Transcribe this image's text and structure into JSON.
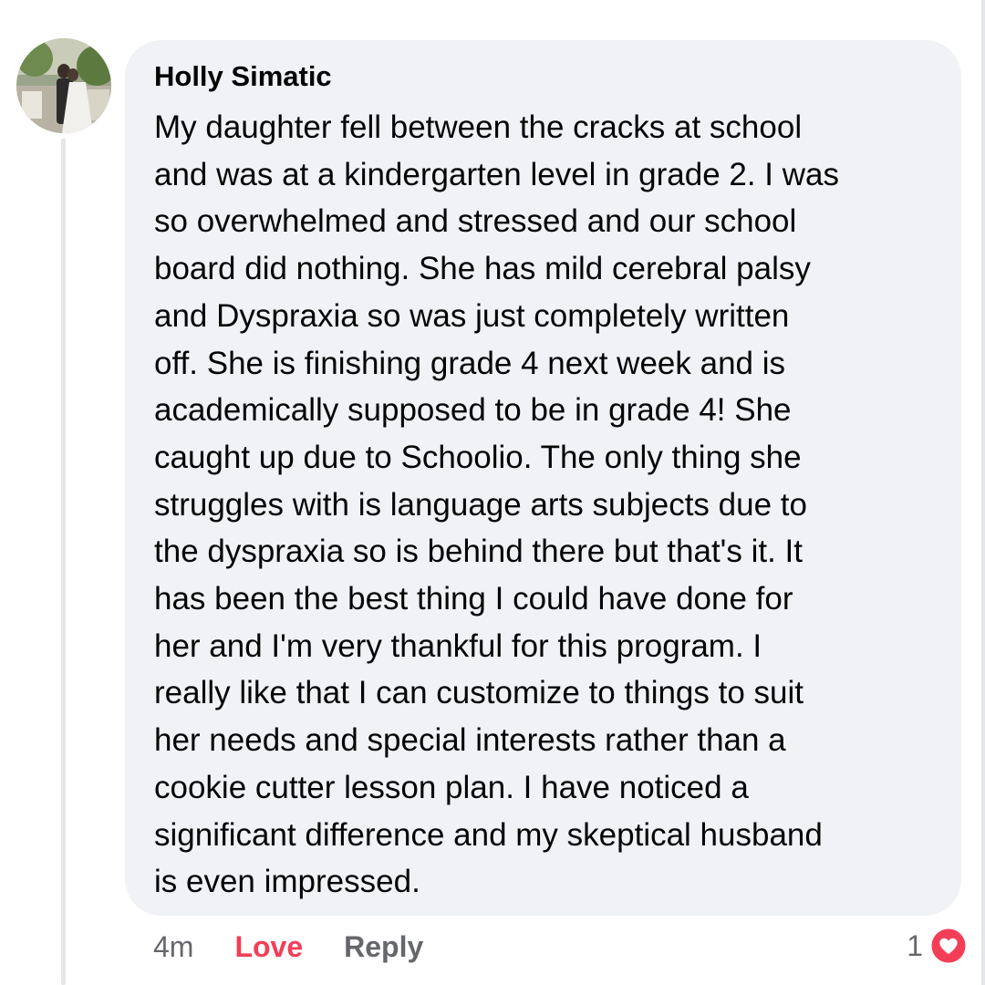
{
  "comment": {
    "author": "Holly Simatic",
    "lines": [
      "My daughter fell between the cracks at school",
      "and was at a kindergarten level in grade 2.  I was",
      "so overwhelmed and stressed and our school",
      "board did nothing.  She has mild cerebral palsy",
      "and Dyspraxia so was just completely written",
      "off. She is finishing grade 4 next week and is",
      "academically supposed to be in grade 4! She",
      "caught up due to Schoolio. The only thing she",
      "struggles with is language arts subjects due to",
      "the dyspraxia so is behind there but that's it. It",
      "has been the best thing I could have done for",
      "her and I'm very thankful for this program. I",
      "really like that I can customize to things to suit",
      "her needs and special interests rather than a",
      "cookie cutter lesson plan. I have noticed a",
      "significant difference and my skeptical husband",
      "is even impressed."
    ]
  },
  "actions": {
    "time": "4m",
    "love_label": "Love",
    "reply_label": "Reply"
  },
  "reactions": {
    "count": "1",
    "icon": "heart-icon"
  },
  "colors": {
    "bubble_bg": "#f0f2f5",
    "text": "#050505",
    "secondary": "#65676b",
    "love": "#f33e58"
  }
}
